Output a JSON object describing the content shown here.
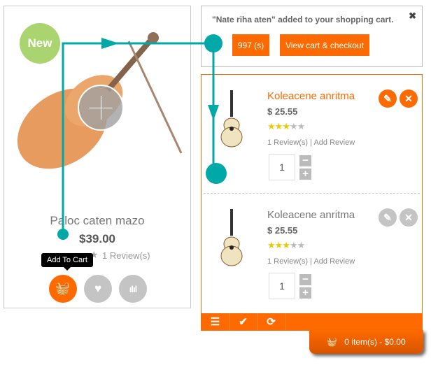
{
  "product": {
    "badge": "New",
    "name": "Paloc caten mazo",
    "price": "$39.00",
    "reviews": "1 Review(s)",
    "tooltip": "Add To Cart"
  },
  "notice": {
    "message": "\"Nate riha aten\" added to your shopping cart.",
    "count_button": "997 (s)",
    "checkout_button": "View cart & checkout",
    "close": "✖"
  },
  "cart": {
    "items": [
      {
        "title": "Koleacene anritma",
        "price": "$ 25.55",
        "rating": 3,
        "max_rating": 5,
        "reviews": "1 Review(s)",
        "add_review": "Add Review",
        "qty": "1",
        "active": true
      },
      {
        "title": "Koleacene anritma",
        "price": "$ 25.55",
        "rating": 3,
        "max_rating": 5,
        "reviews": "1 Review(s)",
        "add_review": "Add Review",
        "qty": "1",
        "active": false
      }
    ],
    "total": "0 item(s) - $0.00"
  },
  "colors": {
    "accent": "#ff6a00",
    "annotation": "#00a9a8",
    "badge": "#8dc63f",
    "star": "#f0c800"
  }
}
